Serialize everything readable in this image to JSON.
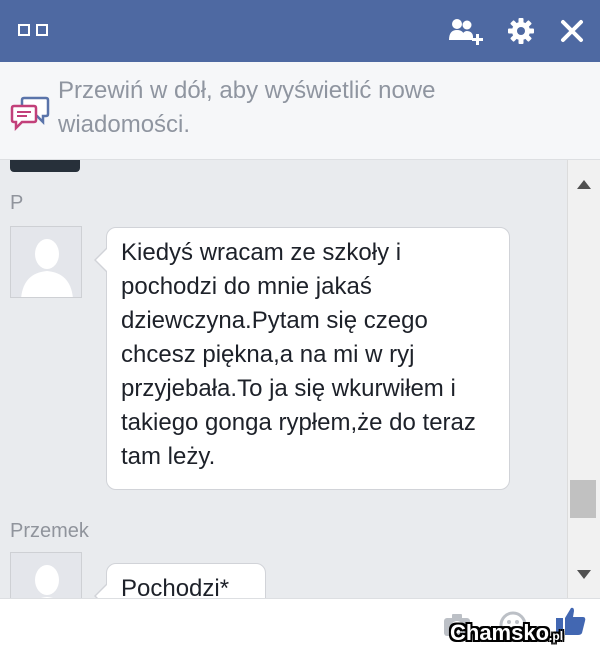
{
  "header": {
    "icons": [
      "window-squares-icon",
      "add-people-icon",
      "gear-icon",
      "close-icon"
    ]
  },
  "notice": {
    "text": "Przewiń w dół, aby wyświetlić nowe wiadomości.",
    "icon": "chat-bubbles-icon"
  },
  "messages": [
    {
      "sender": "P",
      "text": "Kiedyś wracam ze szkoły i pochodzi do mnie jakaś dziewczyna.Pytam się czego chcesz piękna,a na mi w ryj przyjebała.To ja się wkurwiłem i takiego gonga rypłem,że do teraz tam leży."
    },
    {
      "sender": "Przemek",
      "text": "Pochodzi*"
    }
  ],
  "composer": {
    "icons": [
      "camera-icon",
      "emoji-icon",
      "like-icon"
    ]
  },
  "watermark": {
    "name": "Chamsko",
    "suffix": ".pl"
  },
  "colors": {
    "header": "#4e69a2",
    "chat_bg": "#e9ebee",
    "notice_text": "#8f95a0",
    "like": "#4267b2"
  }
}
